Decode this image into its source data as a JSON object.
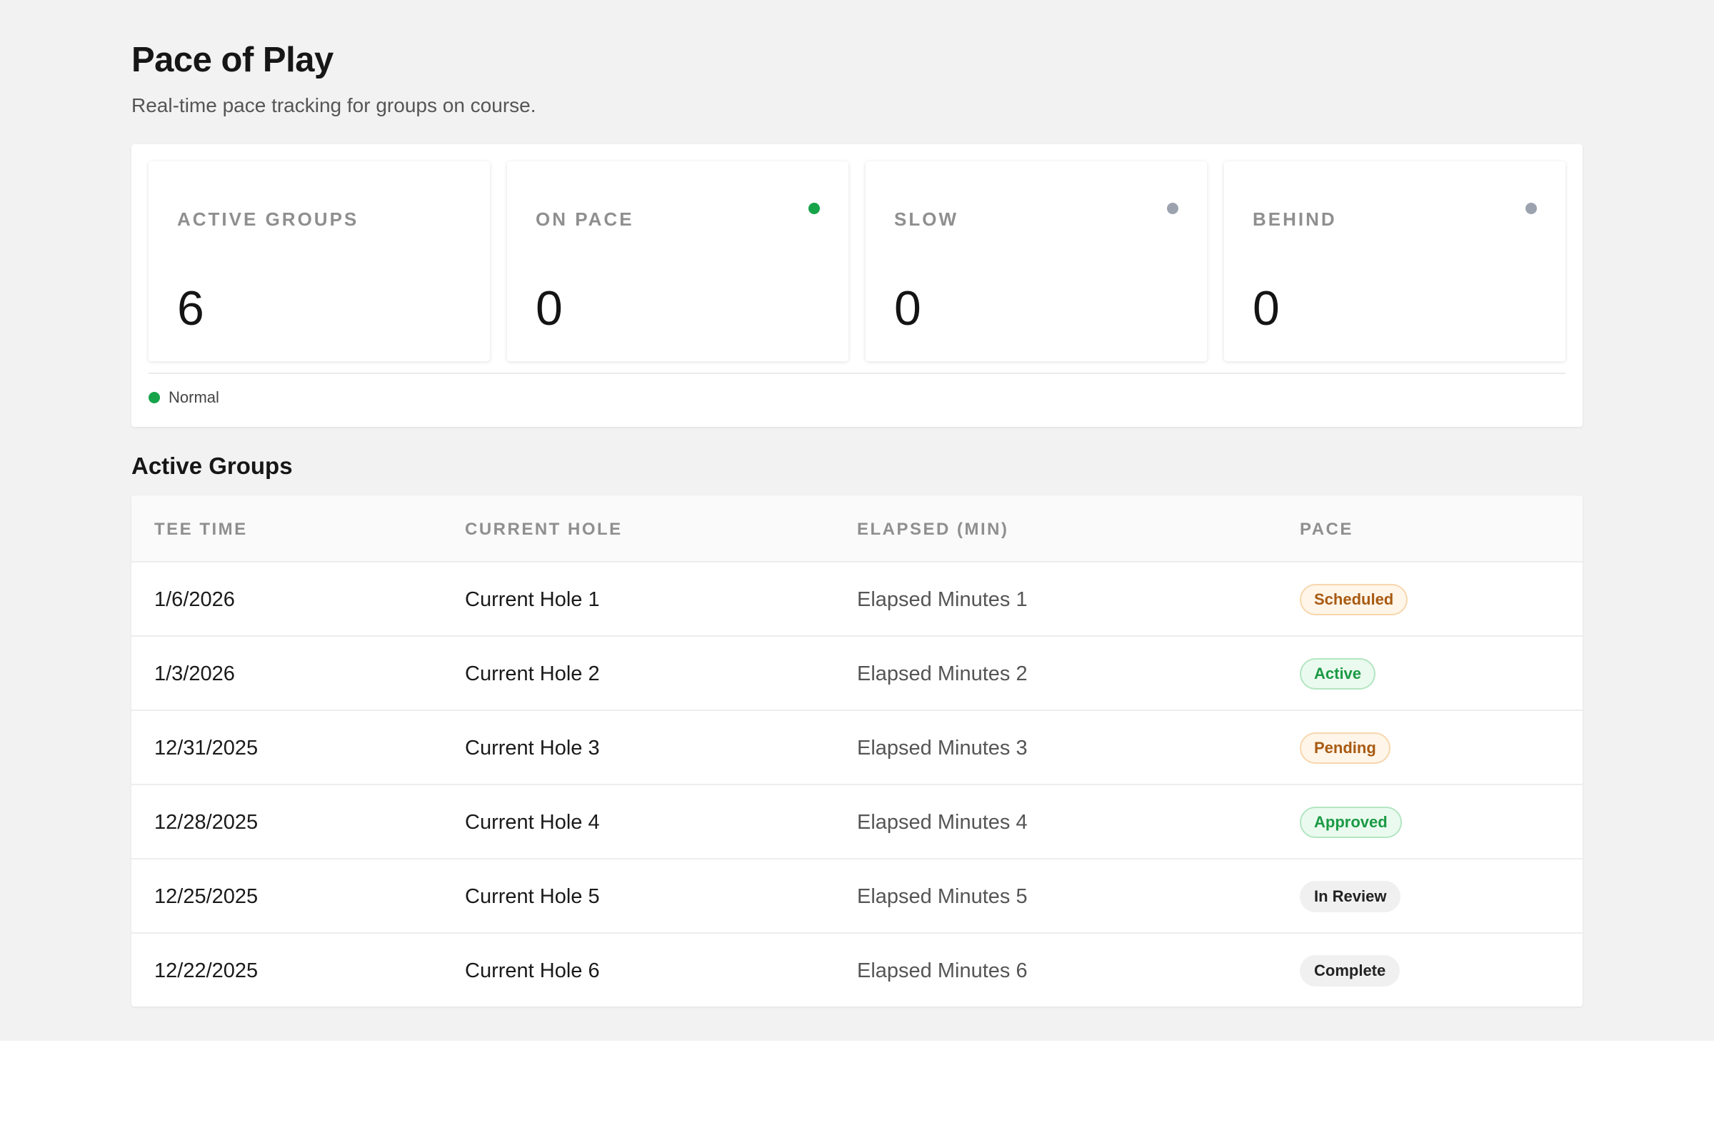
{
  "page": {
    "title": "Pace of Play",
    "subtitle": "Real-time pace tracking for groups on course."
  },
  "stats": [
    {
      "label": "ACTIVE GROUPS",
      "value": "6",
      "dot": null
    },
    {
      "label": "ON PACE",
      "value": "0",
      "dot": "#16a34a"
    },
    {
      "label": "SLOW",
      "value": "0",
      "dot": "#9ca3af"
    },
    {
      "label": "BEHIND",
      "value": "0",
      "dot": "#9ca3af"
    }
  ],
  "legend": {
    "label": "Normal",
    "color": "#16a34a"
  },
  "groups_section": {
    "title": "Active Groups",
    "columns": [
      "TEE TIME",
      "CURRENT HOLE",
      "ELAPSED (MIN)",
      "PACE"
    ],
    "rows": [
      {
        "tee_time": "1/6/2026",
        "current_hole": "Current Hole 1",
        "elapsed": "Elapsed Minutes 1",
        "pace": "Scheduled",
        "pace_tone": "warn"
      },
      {
        "tee_time": "1/3/2026",
        "current_hole": "Current Hole 2",
        "elapsed": "Elapsed Minutes 2",
        "pace": "Active",
        "pace_tone": "ok"
      },
      {
        "tee_time": "12/31/2025",
        "current_hole": "Current Hole 3",
        "elapsed": "Elapsed Minutes 3",
        "pace": "Pending",
        "pace_tone": "warn"
      },
      {
        "tee_time": "12/28/2025",
        "current_hole": "Current Hole 4",
        "elapsed": "Elapsed Minutes 4",
        "pace": "Approved",
        "pace_tone": "ok"
      },
      {
        "tee_time": "12/25/2025",
        "current_hole": "Current Hole 5",
        "elapsed": "Elapsed Minutes 5",
        "pace": "In Review",
        "pace_tone": "neutral"
      },
      {
        "tee_time": "12/22/2025",
        "current_hole": "Current Hole 6",
        "elapsed": "Elapsed Minutes 6",
        "pace": "Complete",
        "pace_tone": "neutral"
      }
    ]
  },
  "colors": {
    "background": "#f2f2f2",
    "success": "#16a34a",
    "inactive": "#9ca3af",
    "warning_text": "#a85a12"
  }
}
